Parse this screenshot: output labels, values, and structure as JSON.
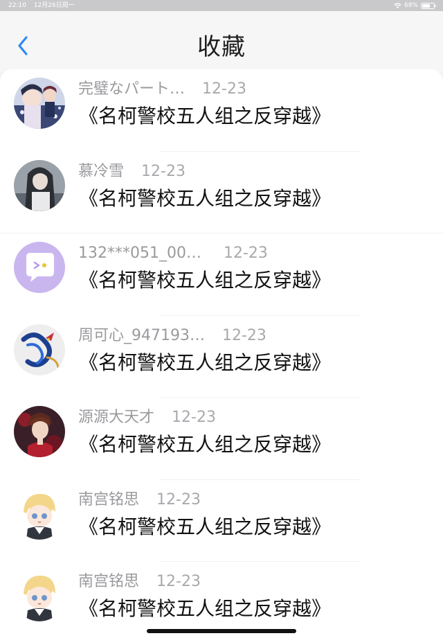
{
  "status_bar": {
    "time": "22:10",
    "date": "12月26日周一",
    "battery": "68%"
  },
  "nav": {
    "title": "收藏",
    "back_icon": "chevron-left-icon"
  },
  "items": [
    {
      "name": "完璧なパート…",
      "date": "12-23",
      "title": "《名柯警校五人组之反穿越》",
      "avatar": "anime-couple-avatar"
    },
    {
      "name": "慕冷雪",
      "date": "12-23",
      "title": "《名柯警校五人组之反穿越》",
      "avatar": "dark-haired-girl-avatar"
    },
    {
      "name": "132***051_009…",
      "date": "12-23",
      "title": "《名柯警校五人组之反穿越》",
      "avatar": "chat-bubble-avatar"
    },
    {
      "name": "周可心_947193…",
      "date": "12-23",
      "title": "《名柯警校五人组之反穿越》",
      "avatar": "dragon-avatar"
    },
    {
      "name": "源源大天才",
      "date": "12-23",
      "title": "《名柯警校五人组之反穿越》",
      "avatar": "red-anime-avatar"
    },
    {
      "name": "南宫铭思",
      "date": "12-23",
      "title": "《名柯警校五人组之反穿越》",
      "avatar": "blond-chibi-avatar"
    },
    {
      "name": "南宫铭思",
      "date": "12-23",
      "title": "《名柯警校五人组之反穿越》",
      "avatar": "blond-chibi-avatar"
    }
  ],
  "colors": {
    "accent": "#2f8bf0",
    "chat_avatar_bg": "#c9b6ee"
  }
}
